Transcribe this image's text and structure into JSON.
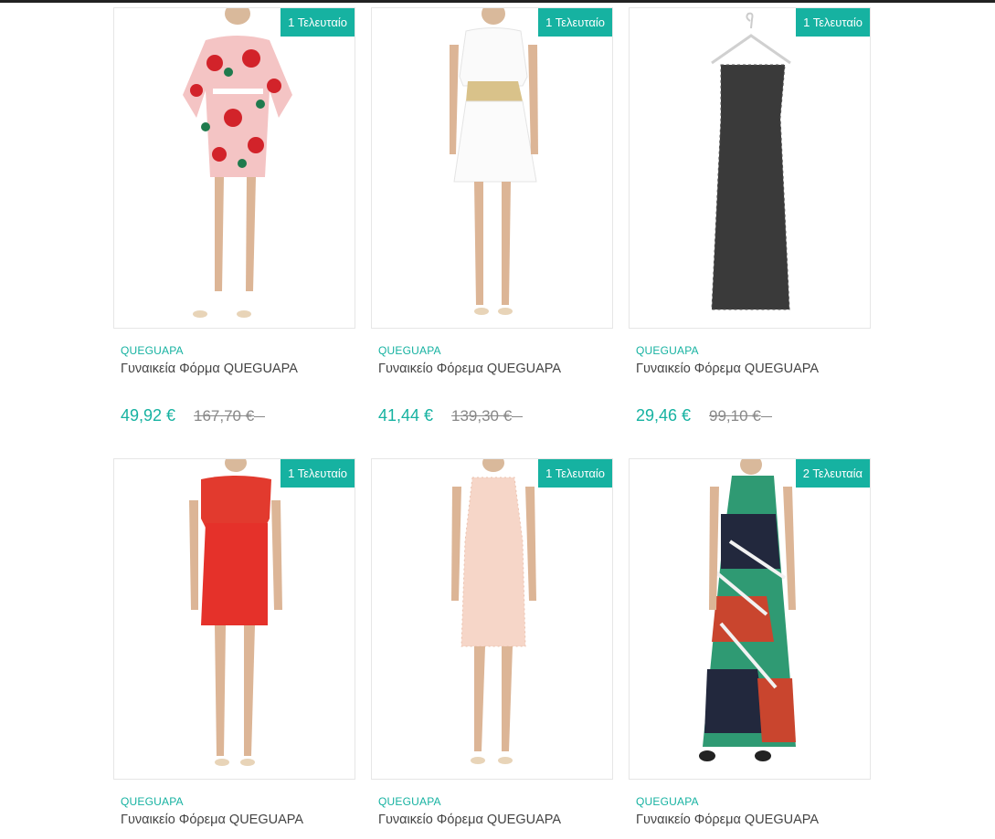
{
  "colors": {
    "accent": "#16b2a1",
    "border": "#e6e6e6"
  },
  "products": [
    {
      "badge": "1 Τελευταίο",
      "brand": "QUEGUAPA",
      "title": "Γυναικεία Φόρμα QUEGUAPA",
      "price": "49,92 €",
      "old_price": "167,70 €",
      "image": "floral-romper"
    },
    {
      "badge": "1 Τελευταίο",
      "brand": "QUEGUAPA",
      "title": "Γυναικείο Φόρεμα QUEGUAPA",
      "price": "41,44 €",
      "old_price": "139,30 €",
      "image": "white-dress-gold-belt"
    },
    {
      "badge": "1 Τελευταίο",
      "brand": "QUEGUAPA",
      "title": "Γυναικείο Φόρεμα QUEGUAPA",
      "price": "29,46 €",
      "old_price": "99,10 €",
      "image": "black-lace-dress-hanger"
    },
    {
      "badge": "1 Τελευταίο",
      "brand": "QUEGUAPA",
      "title": "Γυναικείο Φόρεμα QUEGUAPA",
      "image": "red-ruffle-dress"
    },
    {
      "badge": "1 Τελευταίο",
      "brand": "QUEGUAPA",
      "title": "Γυναικείο Φόρεμα QUEGUAPA",
      "image": "pink-lace-dress"
    },
    {
      "badge": "2 Τελευταία",
      "brand": "QUEGUAPA",
      "title": "Γυναικείο Φόρεμα QUEGUAPA",
      "image": "printed-maxi-dress"
    }
  ]
}
